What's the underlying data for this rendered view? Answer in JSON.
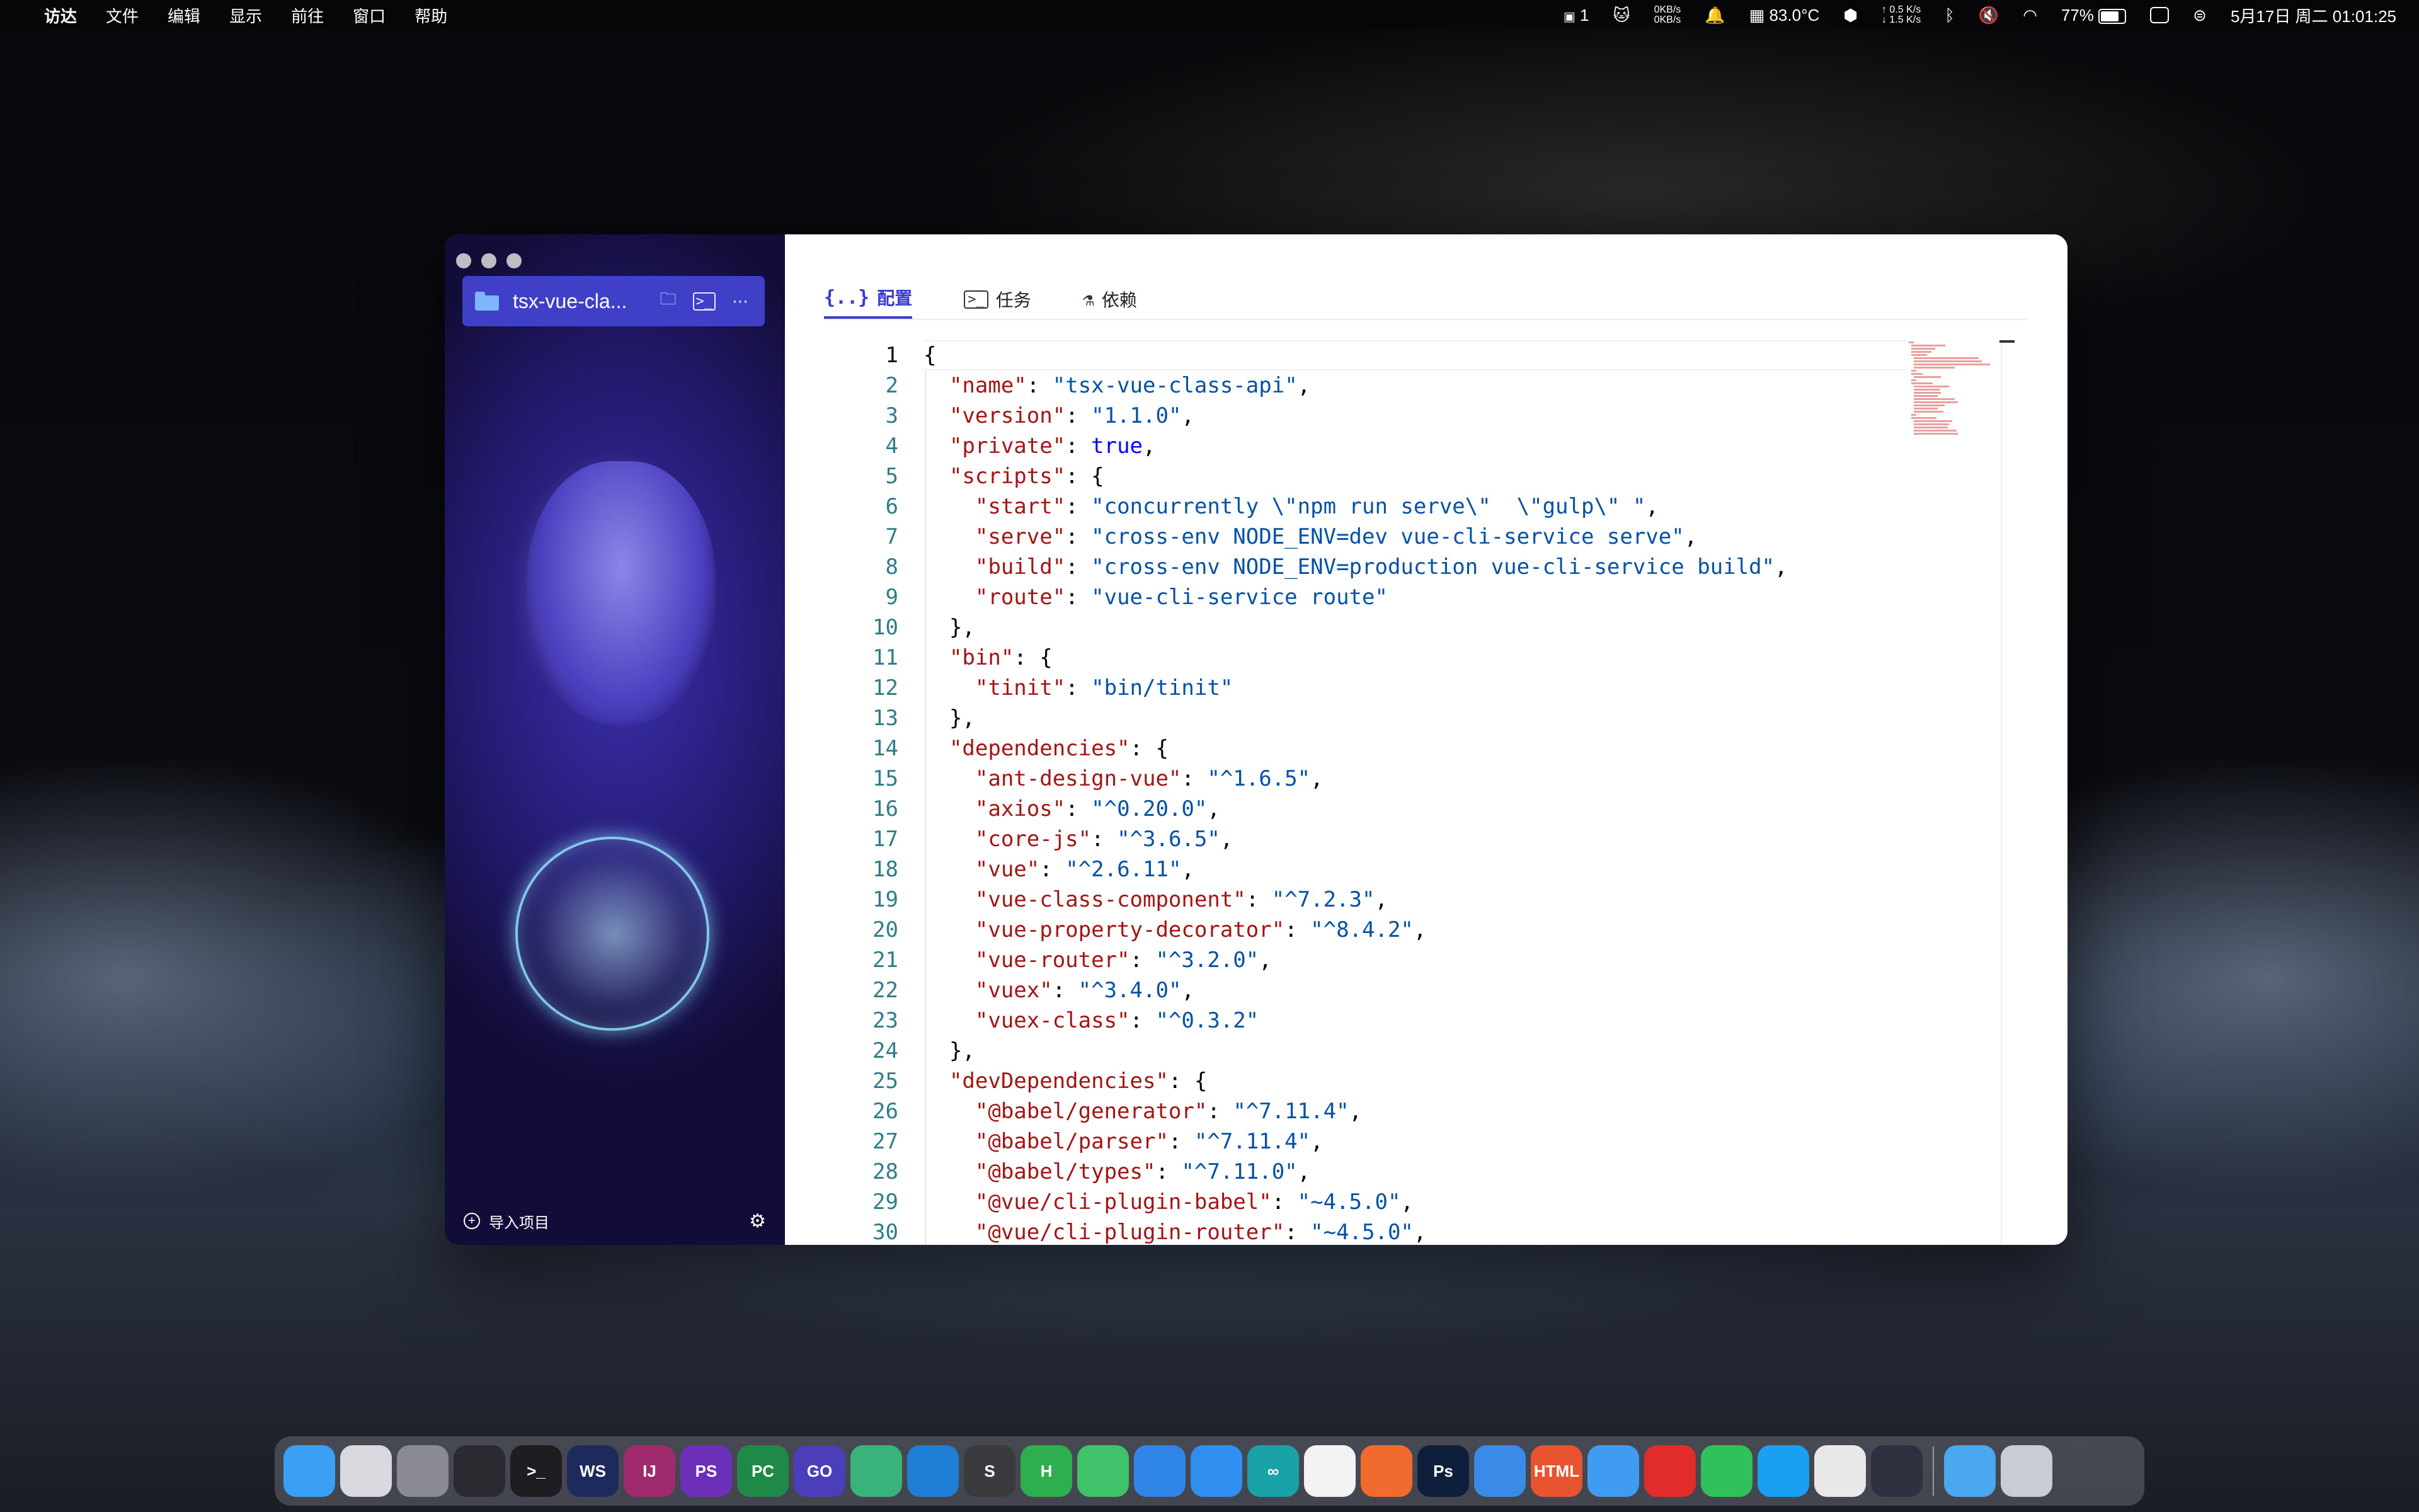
{
  "menubar": {
    "items": [
      "访达",
      "文件",
      "编辑",
      "显示",
      "前往",
      "窗口",
      "帮助"
    ],
    "status": {
      "badge_count": "1",
      "net_up": "0KB/s",
      "net_down": "0KB/s",
      "temperature": "83.0°C",
      "speed_up": "↑ 0.5 K/s",
      "speed_down": "↓ 1.5 K/s",
      "battery": "77%",
      "datetime": "5月17日 周二 01:01:25"
    }
  },
  "sidebar": {
    "project_name": "tsx-vue-cla...",
    "import_label": "导入项目"
  },
  "tabs": [
    {
      "icon": "{..}",
      "label": "配置"
    },
    {
      "icon": ">_",
      "label": "任务"
    },
    {
      "icon": "⚗",
      "label": "依赖"
    }
  ],
  "editor": {
    "lines": [
      "{",
      "  \"name\": \"tsx-vue-class-api\",",
      "  \"version\": \"1.1.0\",",
      "  \"private\": true,",
      "  \"scripts\": {",
      "    \"start\": \"concurrently \\\"npm run serve\\\"  \\\"gulp\\\" \",",
      "    \"serve\": \"cross-env NODE_ENV=dev vue-cli-service serve\",",
      "    \"build\": \"cross-env NODE_ENV=production vue-cli-service build\",",
      "    \"route\": \"vue-cli-service route\"",
      "  },",
      "  \"bin\": {",
      "    \"tinit\": \"bin/tinit\"",
      "  },",
      "  \"dependencies\": {",
      "    \"ant-design-vue\": \"^1.6.5\",",
      "    \"axios\": \"^0.20.0\",",
      "    \"core-js\": \"^3.6.5\",",
      "    \"vue\": \"^2.6.11\",",
      "    \"vue-class-component\": \"^7.2.3\",",
      "    \"vue-property-decorator\": \"^8.4.2\",",
      "    \"vue-router\": \"^3.2.0\",",
      "    \"vuex\": \"^3.4.0\",",
      "    \"vuex-class\": \"^0.3.2\"",
      "  },",
      "  \"devDependencies\": {",
      "    \"@babel/generator\": \"^7.11.4\",",
      "    \"@babel/parser\": \"^7.11.4\",",
      "    \"@babel/types\": \"^7.11.0\",",
      "    \"@vue/cli-plugin-babel\": \"~4.5.0\",",
      "    \"@vue/cli-plugin-router\": \"~4.5.0\","
    ]
  },
  "dock": [
    {
      "name": "finder-icon",
      "text": "",
      "color": "#3aa0f5"
    },
    {
      "name": "launchpad-icon",
      "text": "",
      "color": "#d8d8de"
    },
    {
      "name": "system-preferences-icon",
      "text": "",
      "color": "#8a8a92"
    },
    {
      "name": "activity-monitor-icon",
      "text": "",
      "color": "#2a2a30"
    },
    {
      "name": "terminal-icon",
      "text": ">_",
      "color": "#1e1e22"
    },
    {
      "name": "webstorm-icon",
      "text": "WS",
      "color": "#1f2a5c"
    },
    {
      "name": "intellij-icon",
      "text": "IJ",
      "color": "#a02a6e"
    },
    {
      "name": "phpstorm-icon",
      "text": "PS",
      "color": "#6b2fb8"
    },
    {
      "name": "pycharm-icon",
      "text": "PC",
      "color": "#1f8a48"
    },
    {
      "name": "goland-icon",
      "text": "GO",
      "color": "#4a3fb8"
    },
    {
      "name": "android-studio-icon",
      "text": "",
      "color": "#3ab37a"
    },
    {
      "name": "vscode-icon",
      "text": "",
      "color": "#1f7fd6"
    },
    {
      "name": "sublime-icon",
      "text": "S",
      "color": "#3a3a3f"
    },
    {
      "name": "hbuilder-icon",
      "text": "H",
      "color": "#2fae4f"
    },
    {
      "name": "wechat-devtools-icon",
      "text": "",
      "color": "#3fc26a"
    },
    {
      "name": "xcode-icon",
      "text": "",
      "color": "#2f86e6"
    },
    {
      "name": "app-store-icon",
      "text": "",
      "color": "#2f8ef0"
    },
    {
      "name": "arduino-icon",
      "text": "∞",
      "color": "#1aa2a8"
    },
    {
      "name": "photos-icon",
      "text": "",
      "color": "#f3f3f3"
    },
    {
      "name": "pencil-app-icon",
      "text": "",
      "color": "#f26b2e"
    },
    {
      "name": "photoshop-icon",
      "text": "Ps",
      "color": "#0d1f3b"
    },
    {
      "name": "database-app-icon",
      "text": "",
      "color": "#3a8ae8"
    },
    {
      "name": "html-app-icon",
      "text": "HTML",
      "color": "#e8542f"
    },
    {
      "name": "cat-app-icon",
      "text": "",
      "color": "#3f9cf2"
    },
    {
      "name": "netease-music-icon",
      "text": "",
      "color": "#e22b2b"
    },
    {
      "name": "wechat-icon",
      "text": "",
      "color": "#2fc15a"
    },
    {
      "name": "qq-icon",
      "text": "",
      "color": "#1aa0f0"
    },
    {
      "name": "chrome-icon",
      "text": "",
      "color": "#e8e8e8"
    },
    {
      "name": "layers-app-icon",
      "text": "",
      "color": "#2e3240"
    }
  ],
  "dock_right": [
    {
      "name": "downloads-folder-icon",
      "text": "",
      "color": "#4aa8f0"
    },
    {
      "name": "trash-icon",
      "text": "",
      "color": "#c8ccd4"
    }
  ]
}
